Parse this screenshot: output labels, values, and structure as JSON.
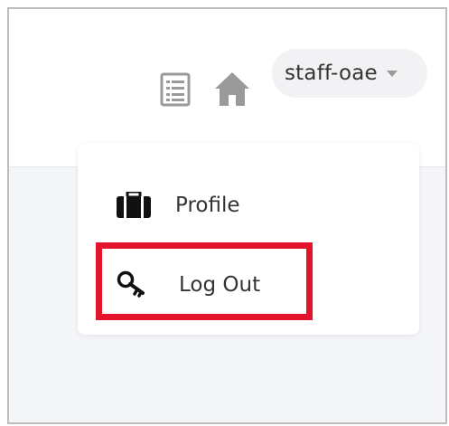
{
  "header": {
    "username": "staff-oae"
  },
  "icons": {
    "list": "list-icon",
    "home": "home-icon",
    "caret": "caret-down-icon",
    "profile": "briefcase-icon",
    "logout": "key-icon"
  },
  "dropdown": {
    "items": [
      {
        "label": "Profile"
      },
      {
        "label": "Log Out"
      }
    ]
  },
  "colors": {
    "highlight": "#e3142b",
    "icon_gray": "#9a9a9a",
    "text": "#333333",
    "content_bg": "#f4f5f9"
  }
}
